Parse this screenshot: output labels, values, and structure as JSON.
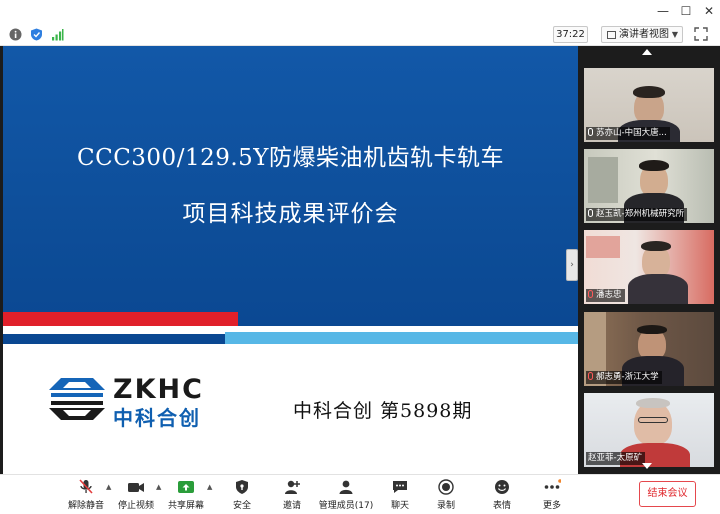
{
  "window": {
    "controls": [
      "—",
      "☐",
      "✕"
    ]
  },
  "infobar": {
    "timer": "37:22",
    "view_label": "演讲者视图",
    "icons": [
      "info-icon",
      "shield-icon",
      "signal-icon"
    ]
  },
  "slide": {
    "title_line1": "CCC300/129.5Y防爆柴油机齿轨卡轨车",
    "title_line2": "项目科技成果评价会",
    "logo_text_en": "ZKHC",
    "logo_text_cn": "中科合创",
    "issue_text": "中科合创 第5898期",
    "colors": {
      "blue": "#0d4d98",
      "red": "#e0202a",
      "cyan": "#57b7e6"
    }
  },
  "participants": [
    {
      "name": "苏亦山-中国大唐...",
      "muted": false
    },
    {
      "name": "赵玉凯-郑州机械研究所",
      "muted": false
    },
    {
      "name": "潘志忠",
      "muted": true
    },
    {
      "name": "郝志勇-浙江大学",
      "muted": true
    },
    {
      "name": "赵亚菲-太原矿",
      "muted": false
    }
  ],
  "toolbar": {
    "items": [
      {
        "label": "解除静音",
        "icon": "microphone-muted-icon"
      },
      {
        "label": "停止视频",
        "icon": "video-camera-icon"
      },
      {
        "label": "共享屏幕",
        "icon": "share-screen-icon"
      },
      {
        "label": "安全",
        "icon": "shield-icon"
      },
      {
        "label": "邀请",
        "icon": "add-person-icon"
      },
      {
        "label": "管理成员(17)",
        "icon": "participants-icon"
      },
      {
        "label": "聊天",
        "icon": "chat-icon"
      },
      {
        "label": "录制",
        "icon": "record-icon"
      },
      {
        "label": "表情",
        "icon": "emoji-icon"
      },
      {
        "label": "更多",
        "icon": "more-icon"
      }
    ],
    "end_meeting": "结束会议"
  }
}
